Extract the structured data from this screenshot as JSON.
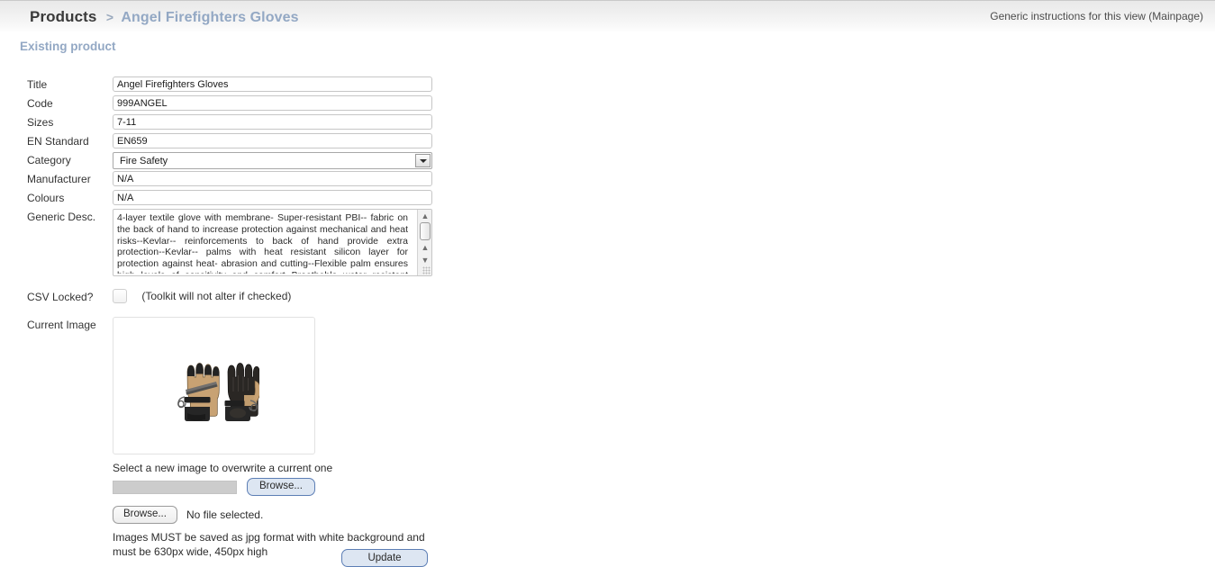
{
  "header": {
    "crumb_root": "Products",
    "crumb_separator": ">",
    "crumb_current": "Angel Firefighters Gloves",
    "instructions": "Generic instructions for this view (Mainpage)"
  },
  "section": {
    "title": "Existing product"
  },
  "form": {
    "title": {
      "label": "Title",
      "value": "Angel Firefighters Gloves"
    },
    "code": {
      "label": "Code",
      "value": "999ANGEL"
    },
    "sizes": {
      "label": "Sizes",
      "value": "7-11"
    },
    "en_standard": {
      "label": "EN Standard",
      "value": "EN659"
    },
    "category": {
      "label": "Category",
      "value": "Fire Safety",
      "options": [
        "Fire Safety"
      ]
    },
    "manufacturer": {
      "label": "Manufacturer",
      "value": "N/A"
    },
    "colours": {
      "label": "Colours",
      "value": "N/A"
    },
    "generic_desc": {
      "label": "Generic Desc.",
      "value": "4-layer textile glove with membrane-  Super-resistant PBI-- fabric on the back of hand to increase protection against mechanical and heat risks--Kevlar-- reinforcements to back of hand provide extra protection--Kevlar-- palms with heat resistant silicon layer for protection against heat- abrasion and cutting--Flexible palm ensures high levels of sensitivity and comfort--Breathable water resistant Porelle-- membrane for protection against water- blood- bacteria and"
    },
    "csv_locked": {
      "label": "CSV Locked?",
      "checked": false,
      "note": "(Toolkit will not alter if checked)"
    },
    "current_image": {
      "label": "Current Image",
      "alt": "Pair of firefighter gloves, tan and black"
    },
    "upload": {
      "instruction": "Select a new image to overwrite a current one",
      "path_value": "",
      "browse_label": "Browse...",
      "file_browse_label": "Browse...",
      "no_file_text": "No file selected.",
      "requirements": "Images MUST be saved as jpg format with white background and must be 630px wide, 450px high"
    },
    "submit": {
      "label": "Update"
    }
  },
  "icons": {
    "scroll_up": "▲",
    "scroll_down": "▼",
    "dropdown": "chevron-down-icon"
  },
  "colors": {
    "accent": "#93a8c4",
    "text": "#333333",
    "button_fill": "#dde6f2",
    "button_border": "#5c7eb5"
  }
}
